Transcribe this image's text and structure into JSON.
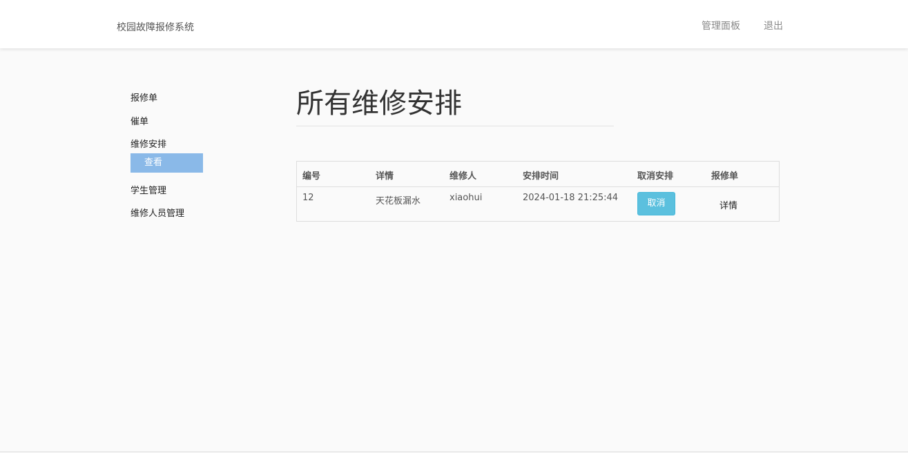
{
  "navbar": {
    "brand": "校园故障报修系统",
    "dashboard_label": "管理面板",
    "logout_label": "退出"
  },
  "sidebar": {
    "items": [
      {
        "label": "报修单"
      },
      {
        "label": "催单"
      },
      {
        "label": "维修安排",
        "sub_items": [
          {
            "label": "查看",
            "active": true
          }
        ]
      },
      {
        "label": "学生管理"
      },
      {
        "label": "维修人员管理"
      }
    ]
  },
  "main": {
    "title": "所有维修安排"
  },
  "table": {
    "columns": [
      "编号",
      "详情",
      "维修人",
      "安排时间",
      "取消安排",
      "报修单"
    ],
    "rows": [
      {
        "id": "12",
        "detail": "天花板漏水",
        "repairer": "xiaohui",
        "time": "2024-01-18 21:25:44",
        "cancel_label": "取消",
        "order_label": "详情"
      }
    ]
  },
  "colors": {
    "sidebar_active_bg": "#8ab9e8",
    "cancel_button_bg": "#5bc0de",
    "page_bg": "#fafafa"
  }
}
